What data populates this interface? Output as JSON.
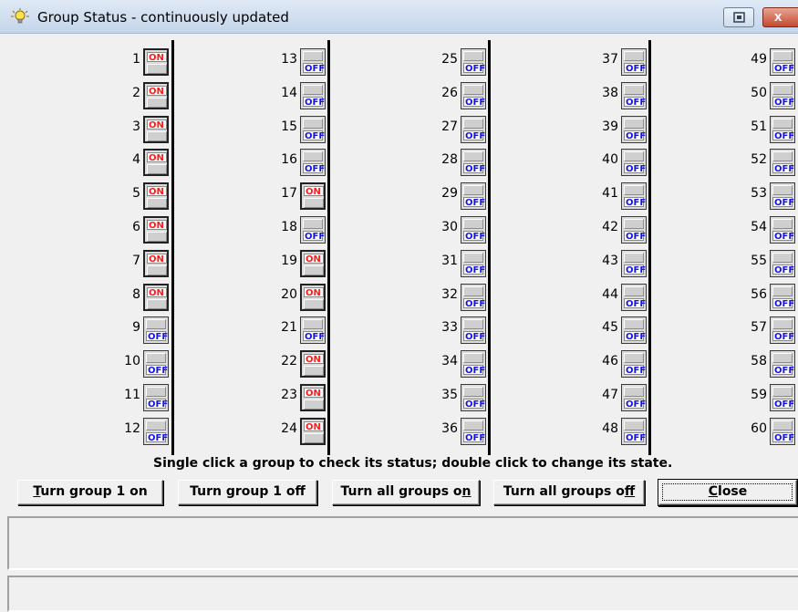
{
  "window": {
    "title": "Group Status - continuously updated",
    "title_icon": "lightbulb-icon",
    "restore_icon": "restore-icon",
    "close_icon": "close-icon",
    "close_glyph": "x"
  },
  "groups": [
    {
      "n": "1",
      "state": "ON"
    },
    {
      "n": "2",
      "state": "ON"
    },
    {
      "n": "3",
      "state": "ON"
    },
    {
      "n": "4",
      "state": "ON"
    },
    {
      "n": "5",
      "state": "ON"
    },
    {
      "n": "6",
      "state": "ON"
    },
    {
      "n": "7",
      "state": "ON"
    },
    {
      "n": "8",
      "state": "ON"
    },
    {
      "n": "9",
      "state": "OFF"
    },
    {
      "n": "10",
      "state": "OFF"
    },
    {
      "n": "11",
      "state": "OFF"
    },
    {
      "n": "12",
      "state": "OFF"
    },
    {
      "n": "13",
      "state": "OFF"
    },
    {
      "n": "14",
      "state": "OFF"
    },
    {
      "n": "15",
      "state": "OFF"
    },
    {
      "n": "16",
      "state": "OFF"
    },
    {
      "n": "17",
      "state": "ON"
    },
    {
      "n": "18",
      "state": "OFF"
    },
    {
      "n": "19",
      "state": "ON"
    },
    {
      "n": "20",
      "state": "ON"
    },
    {
      "n": "21",
      "state": "OFF"
    },
    {
      "n": "22",
      "state": "ON"
    },
    {
      "n": "23",
      "state": "ON"
    },
    {
      "n": "24",
      "state": "ON"
    },
    {
      "n": "25",
      "state": "OFF"
    },
    {
      "n": "26",
      "state": "OFF"
    },
    {
      "n": "27",
      "state": "OFF"
    },
    {
      "n": "28",
      "state": "OFF"
    },
    {
      "n": "29",
      "state": "OFF"
    },
    {
      "n": "30",
      "state": "OFF"
    },
    {
      "n": "31",
      "state": "OFF"
    },
    {
      "n": "32",
      "state": "OFF"
    },
    {
      "n": "33",
      "state": "OFF"
    },
    {
      "n": "34",
      "state": "OFF"
    },
    {
      "n": "35",
      "state": "OFF"
    },
    {
      "n": "36",
      "state": "OFF"
    },
    {
      "n": "37",
      "state": "OFF"
    },
    {
      "n": "38",
      "state": "OFF"
    },
    {
      "n": "39",
      "state": "OFF"
    },
    {
      "n": "40",
      "state": "OFF"
    },
    {
      "n": "41",
      "state": "OFF"
    },
    {
      "n": "42",
      "state": "OFF"
    },
    {
      "n": "43",
      "state": "OFF"
    },
    {
      "n": "44",
      "state": "OFF"
    },
    {
      "n": "45",
      "state": "OFF"
    },
    {
      "n": "46",
      "state": "OFF"
    },
    {
      "n": "47",
      "state": "OFF"
    },
    {
      "n": "48",
      "state": "OFF"
    },
    {
      "n": "49",
      "state": "OFF"
    },
    {
      "n": "50",
      "state": "OFF"
    },
    {
      "n": "51",
      "state": "OFF"
    },
    {
      "n": "52",
      "state": "OFF"
    },
    {
      "n": "53",
      "state": "OFF"
    },
    {
      "n": "54",
      "state": "OFF"
    },
    {
      "n": "55",
      "state": "OFF"
    },
    {
      "n": "56",
      "state": "OFF"
    },
    {
      "n": "57",
      "state": "OFF"
    },
    {
      "n": "58",
      "state": "OFF"
    },
    {
      "n": "59",
      "state": "OFF"
    },
    {
      "n": "60",
      "state": "OFF"
    }
  ],
  "hint": "Single click a group to check its status; double click to change its state.",
  "buttons": {
    "group_on": {
      "underline": "T",
      "rest": "urn group 1 on"
    },
    "group_off": {
      "pre": "Turn group 1 off"
    },
    "all_on": {
      "pre": "Turn all groups o",
      "underline": "n"
    },
    "all_off": {
      "pre": "Turn all groups o",
      "underline": "f",
      "rest": "f"
    },
    "close": {
      "underline": "C",
      "rest": "lose"
    }
  },
  "colors": {
    "on_text": "#ff1a1a",
    "off_text": "#1414e6"
  }
}
